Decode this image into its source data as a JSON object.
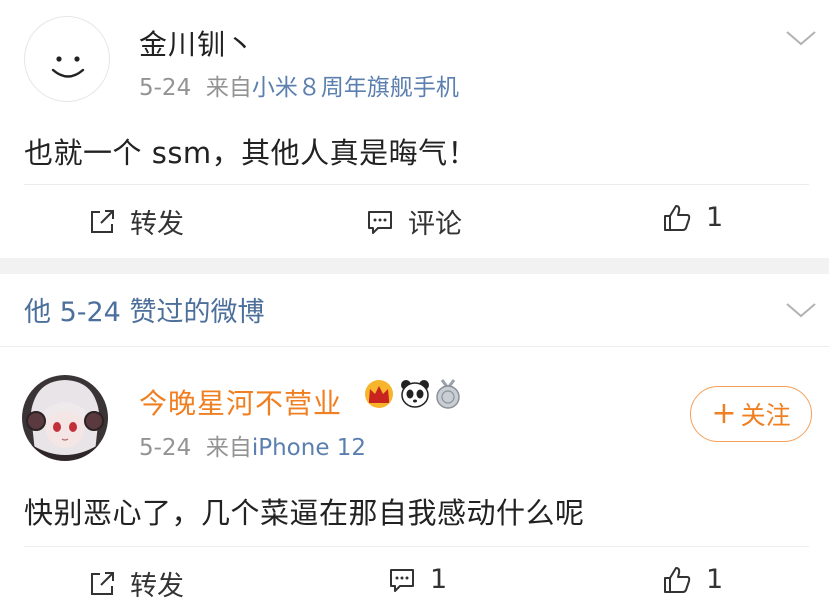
{
  "post1": {
    "username": "金川钏丶",
    "date": "5-24",
    "from_label": "来自",
    "source": "小米８周年旗舰手机",
    "content": "也就一个 ssm，其他人真是晦气！",
    "actions": {
      "repost_label": "转发",
      "comment_label": "评论",
      "like_count": "1"
    },
    "avatar_icon": "smiley-face-icon"
  },
  "section": {
    "title": "他 5-24 赞过的微博"
  },
  "post2": {
    "username": "今晚星河不营业",
    "date": "5-24",
    "from_label": "来自",
    "source": "iPhone 12",
    "content": "快别恶心了，几个菜逼在那自我感动什么呢",
    "follow_label": "关注",
    "follow_plus": "+",
    "badges": [
      "crown-badge-icon",
      "panda-badge-icon",
      "medal-badge-icon"
    ],
    "actions": {
      "repost_label": "转发",
      "comment_count": "1",
      "like_count": "1"
    }
  },
  "colors": {
    "name_orange": "#f07f22",
    "link_blue": "#5b7fae",
    "meta_gray": "#939393",
    "divider": "#ececec",
    "gap": "#f2f2f2"
  }
}
